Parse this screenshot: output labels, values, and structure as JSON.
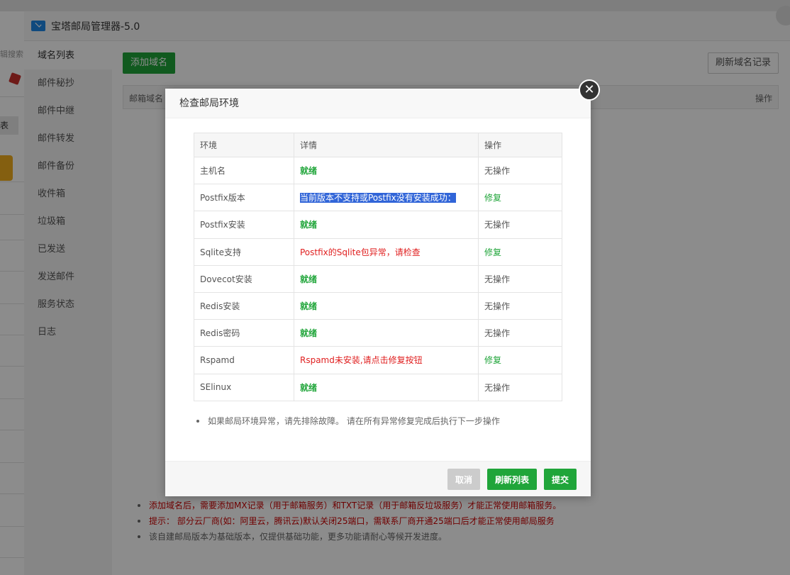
{
  "app": {
    "title": "宝塔邮局管理器-5.0"
  },
  "background": {
    "search_text": "辑搜索",
    "tab_text": "表"
  },
  "sidebar": {
    "items": [
      {
        "label": "域名列表"
      },
      {
        "label": "邮件秘抄"
      },
      {
        "label": "邮件中继"
      },
      {
        "label": "邮件转发"
      },
      {
        "label": "邮件备份"
      },
      {
        "label": "收件箱"
      },
      {
        "label": "垃圾箱"
      },
      {
        "label": "已发送"
      },
      {
        "label": "发送邮件"
      },
      {
        "label": "服务状态"
      },
      {
        "label": "日志"
      }
    ]
  },
  "main": {
    "add_domain_label": "添加域名",
    "refresh_dns_label": "刷新域名记录",
    "table_headers": {
      "domain": "邮箱域名",
      "action": "操作"
    },
    "tips": [
      "添加域名后，需要添加MX记录（用于邮箱服务）和TXT记录（用于邮箱反垃圾服务）才能正常使用邮箱服务。",
      "提示： 部分云厂商(如：阿里云，腾讯云)默认关闭25端口，需联系厂商开通25端口后才能正常使用邮局服务",
      "该自建邮局版本为基础版本，仅提供基础功能，更多功能请耐心等候开发进度。"
    ]
  },
  "dialog": {
    "title": "检查邮局环境",
    "close_label": "✕",
    "headers": {
      "env": "环境",
      "detail": "详情",
      "action": "操作"
    },
    "rows": [
      {
        "env": "主机名",
        "detail": "就绪",
        "action": "无操作"
      },
      {
        "env": "Postfix版本",
        "detail": "当前版本不支持或Postfix没有安装成功：",
        "action": "修复"
      },
      {
        "env": "Postfix安装",
        "detail": "就绪",
        "action": "无操作"
      },
      {
        "env": "Sqlite支持",
        "detail": "Postfix的Sqlite包异常，请检查",
        "action": "修复"
      },
      {
        "env": "Dovecot安装",
        "detail": "就绪",
        "action": "无操作"
      },
      {
        "env": "Redis安装",
        "detail": "就绪",
        "action": "无操作"
      },
      {
        "env": "Redis密码",
        "detail": "就绪",
        "action": "无操作"
      },
      {
        "env": "Rspamd",
        "detail": "Rspamd未安装,请点击修复按钮",
        "action": "修复"
      },
      {
        "env": "SElinux",
        "detail": "就绪",
        "action": "无操作"
      }
    ],
    "note": "如果邮局环境异常，请先排除故障。 请在所有异常修复完成后执行下一步操作",
    "buttons": {
      "cancel": "取消",
      "refresh": "刷新列表",
      "submit": "提交"
    }
  }
}
